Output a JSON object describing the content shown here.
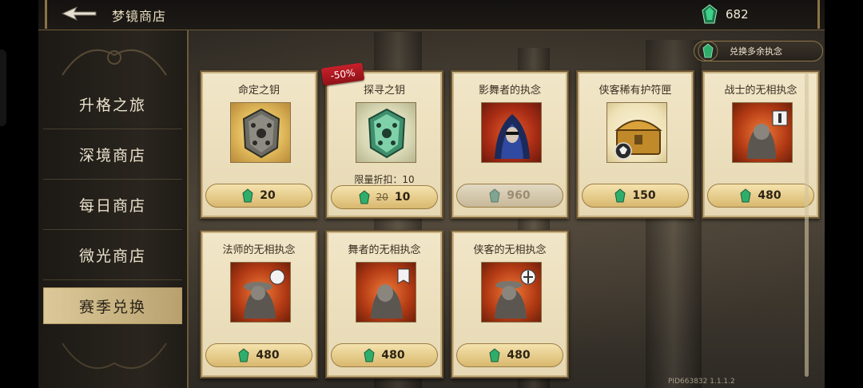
{
  "header": {
    "title": "梦镜商店",
    "currency_amount": "682",
    "back_icon": "back-arrow-icon"
  },
  "menu": {
    "items": [
      {
        "label": "升格之旅",
        "active": false
      },
      {
        "label": "深境商店",
        "active": false
      },
      {
        "label": "每日商店",
        "active": false
      },
      {
        "label": "微光商店",
        "active": false
      },
      {
        "label": "赛季兑换",
        "active": true
      }
    ]
  },
  "exchange_button": {
    "label": "兑换多余执念"
  },
  "discount_badge": "-50%",
  "cards": [
    {
      "name": "命定之钥",
      "price": "20",
      "icon": "golden-rune-stone-icon"
    },
    {
      "name": "探寻之钥",
      "price": "10",
      "original_price": "20",
      "limit": "限量折扣：10",
      "icon": "green-rune-stone-icon"
    },
    {
      "name": "影舞者的执念",
      "price": "960",
      "disabled": true,
      "icon": "shadow-dancer-portrait-icon"
    },
    {
      "name": "侠客稀有护符匣",
      "price": "150",
      "icon": "treasure-chest-icon"
    },
    {
      "name": "战士的无相执念",
      "price": "480",
      "icon": "warrior-statue-icon"
    },
    {
      "name": "法师的无相执念",
      "price": "480",
      "icon": "mage-statue-icon"
    },
    {
      "name": "舞者的无相执念",
      "price": "480",
      "icon": "dancer-statue-icon"
    },
    {
      "name": "侠客的无相执念",
      "price": "480",
      "icon": "ranger-statue-icon"
    }
  ],
  "version": "PID663832  1.1.1.2",
  "colors": {
    "accent_gold": "#d9b86e",
    "gem_green": "#2fae6b",
    "badge_red": "#c8202a"
  }
}
